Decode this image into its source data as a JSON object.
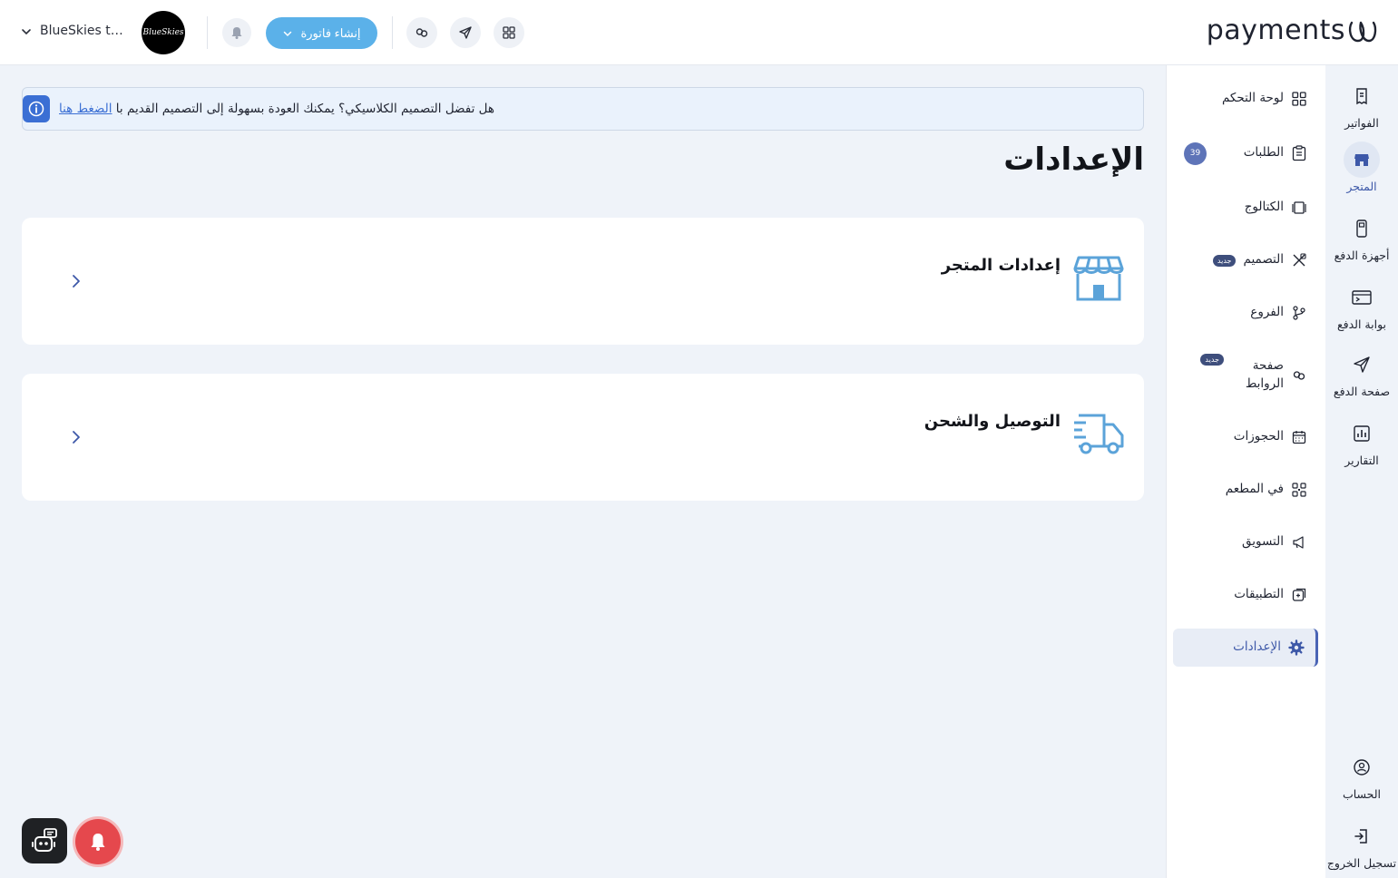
{
  "header": {
    "logo_text": "payments",
    "user_name": "BlueSkies testi...",
    "avatar_text": "BlueSkies",
    "create_invoice_label": "إنشاء فاتورة"
  },
  "rail": {
    "items": [
      {
        "label": "الفواتير",
        "icon": "invoice-icon",
        "active": false
      },
      {
        "label": "المتجر",
        "icon": "store-icon",
        "active": true
      },
      {
        "label": "أجهزة الدفع",
        "icon": "pos-device-icon",
        "active": false
      },
      {
        "label": "بوابة الدفع",
        "icon": "gateway-icon",
        "active": false
      },
      {
        "label": "صفحة الدفع",
        "icon": "send-icon",
        "active": false
      },
      {
        "label": "التقارير",
        "icon": "reports-icon",
        "active": false
      }
    ],
    "bottom": [
      {
        "label": "الحساب",
        "icon": "account-icon"
      },
      {
        "label": "تسجيل الخروج",
        "icon": "logout-icon"
      }
    ]
  },
  "sidebar": {
    "items": [
      {
        "label": "لوحة التحكم",
        "icon": "dashboard-icon"
      },
      {
        "label": "الطلبات",
        "icon": "orders-icon",
        "count": "39"
      },
      {
        "label": "الكتالوج",
        "icon": "catalog-icon"
      },
      {
        "label": "التصميم",
        "icon": "design-icon",
        "badge": "جديد"
      },
      {
        "label": "الفروع",
        "icon": "branches-icon"
      },
      {
        "label": "صفحة الروابط",
        "label_line1": "صفحة",
        "label_line2": "الروابط",
        "icon": "links-icon",
        "badge": "جديد"
      },
      {
        "label": "الحجوزات",
        "icon": "calendar-icon"
      },
      {
        "label": "في المطعم",
        "icon": "qr-icon"
      },
      {
        "label": "التسويق",
        "icon": "megaphone-icon"
      },
      {
        "label": "التطبيقات",
        "icon": "apps-icon"
      },
      {
        "label": "الإعدادات",
        "icon": "settings-icon",
        "active": true
      }
    ]
  },
  "banner": {
    "text": "هل تفضل التصميم الكلاسيكي؟ يمكنك العودة بسهولة إلى التصميم القديم با",
    "link": "الضغط هنا"
  },
  "page": {
    "title": "الإعدادات"
  },
  "cards": [
    {
      "title": "إعدادات المتجر",
      "icon": "store-icon"
    },
    {
      "title": "التوصيل والشحن",
      "icon": "truck-icon"
    }
  ],
  "colors": {
    "accent": "#3d58a8",
    "primary_button": "#5bb1e9",
    "background": "#eff3f9",
    "card_icon": "#5ba3d9",
    "danger": "#e5484d"
  }
}
